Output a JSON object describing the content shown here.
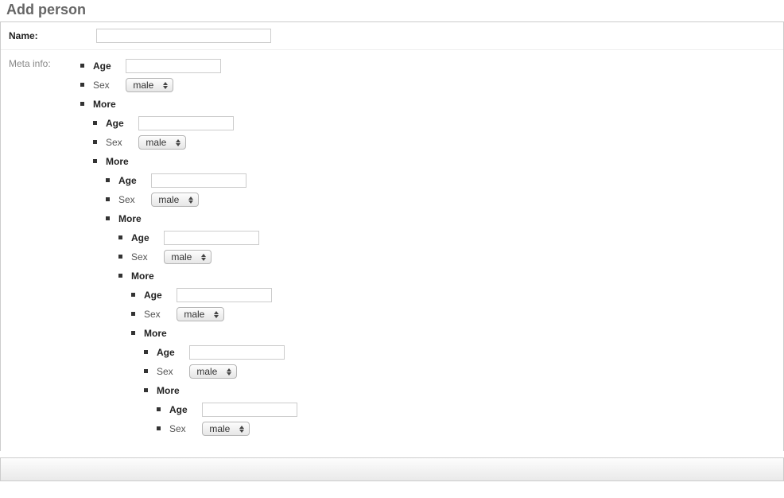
{
  "form": {
    "title": "Add person",
    "name_label": "Name:",
    "name_value": "",
    "meta_label": "Meta info:"
  },
  "labels": {
    "age": "Age",
    "sex": "Sex",
    "more": "More"
  },
  "select_value": "male",
  "levels": [
    {
      "age": "",
      "sex": "male",
      "has_more": true
    },
    {
      "age": "",
      "sex": "male",
      "has_more": true
    },
    {
      "age": "",
      "sex": "male",
      "has_more": true
    },
    {
      "age": "",
      "sex": "male",
      "has_more": true
    },
    {
      "age": "",
      "sex": "male",
      "has_more": true
    },
    {
      "age": "",
      "sex": "male",
      "has_more": true
    },
    {
      "age": "",
      "sex": "male",
      "has_more": false
    }
  ]
}
